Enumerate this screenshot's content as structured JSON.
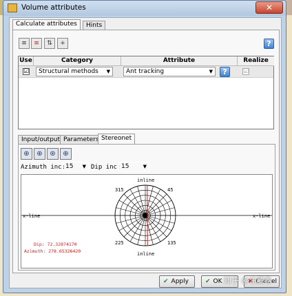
{
  "window": {
    "title": "Volume attributes",
    "close_glyph": "✕"
  },
  "main_tabs": [
    {
      "label": "Calculate attributes"
    },
    {
      "label": "Hints"
    }
  ],
  "toolbar_icons": [
    "new-row-icon",
    "delete-row-icon",
    "move-row-icon",
    "insert-row-icon"
  ],
  "table": {
    "headers": {
      "use": "Use",
      "category": "Category",
      "attribute": "Attribute",
      "realize": "Realize"
    },
    "rows": [
      {
        "use": "☑",
        "category": "Structural methods",
        "attribute": "Ant tracking",
        "realize": "☑"
      }
    ],
    "dropdown_glyph": "▼",
    "help_glyph": "?"
  },
  "sub_tabs": [
    {
      "label": "Input/output"
    },
    {
      "label": "Parameters"
    },
    {
      "label": "Stereonet"
    }
  ],
  "stereonet_icons": [
    "dip-grid-icon",
    "azimuth-grid-icon",
    "rose-plot-icon",
    "net-plot-icon"
  ],
  "controls": {
    "azimuth_label": "Azimuth inc:",
    "azimuth_value": "15",
    "dip_label": "Dip inc:",
    "dip_value": "15"
  },
  "stereonet": {
    "labels": {
      "top": "inline",
      "bottom": "inline",
      "left": "x-line",
      "right": "x-line",
      "deg_315": "315",
      "deg_45": "45",
      "deg_225": "225",
      "deg_135": "135"
    },
    "dip_readout": "Dip: 72.32874170",
    "azimuth_readout": "Azimuth: 278.65326420",
    "selected_dip_deg": 72.3287417,
    "selected_azimuth_deg": 278.6532642,
    "readout_color": "#d01a1a"
  },
  "buttons": {
    "apply": "Apply",
    "ok": "OK",
    "cancel": "Cancel"
  },
  "watermark": "知乎 @油藏卷"
}
